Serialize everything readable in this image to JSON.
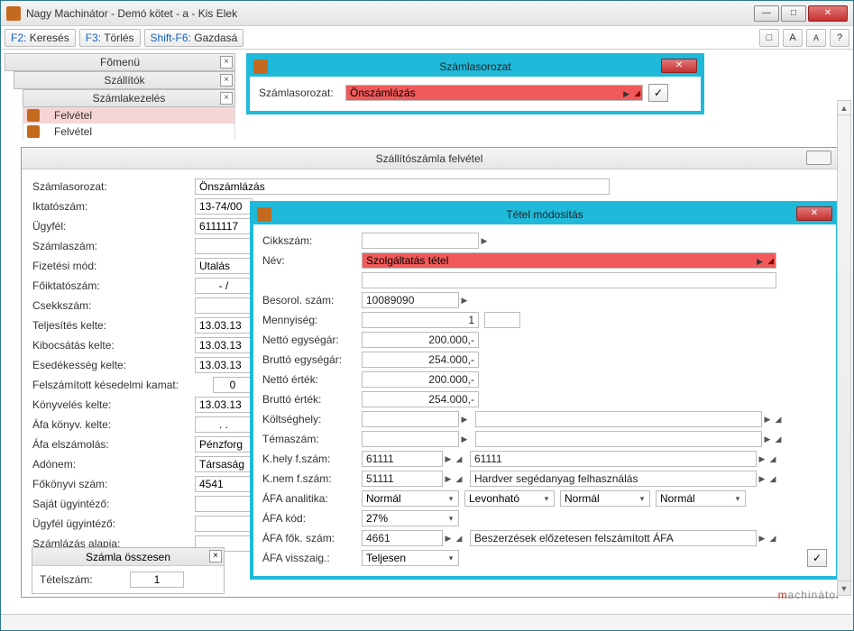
{
  "window": {
    "title": "Nagy Machinátor - Demó kötet - a - Kis Elek"
  },
  "toolbar": {
    "f2_hk": "F2:",
    "f2_lbl": "Keresés",
    "f3_hk": "F3:",
    "f3_lbl": "Törlés",
    "sf6_hk": "Shift-F6:",
    "sf6_lbl": "Gazdasá",
    "help": "?"
  },
  "panels": {
    "fomenu": "Fõmenü",
    "szallitok": "Szállítók",
    "szamlakezeles": "Számlakezelés",
    "felvetel1": "Felvétel",
    "felvetel2": "Felvétel"
  },
  "serial_modal": {
    "title": "Számlasorozat",
    "label": "Számlasorozat:",
    "value": "Önszámlázás"
  },
  "supplier_modal": {
    "title": "Szállítószámla felvétel",
    "rows": {
      "szamlasorozat_l": "Számlasorozat:",
      "szamlasorozat_v": "Önszámlázás",
      "iktatoszam_l": "Iktatószám:",
      "iktatoszam_v": "13-74/00",
      "ugyfel_l": "Ügyfél:",
      "ugyfel_v": "6111117",
      "szamlaszam_l": "Számlaszám:",
      "szamlaszam_v": "",
      "fizmod_l": "Fizetési mód:",
      "fizmod_v": "Utalás",
      "foiktato_l": "Főiktatószám:",
      "foiktato_v": "-   /",
      "csekkszam_l": "Csekkszám:",
      "csekkszam_v": "",
      "telj_l": "Teljesítés kelte:",
      "telj_v": "13.03.13",
      "kib_l": "Kibocsátás kelte:",
      "kib_v": "13.03.13",
      "esed_l": "Esedékesség kelte:",
      "esed_v": "13.03.13",
      "kesedelmi_l": "Felszámított késedelmi kamat:",
      "kesedelmi_v": "0",
      "konyv_l": "Könyvelés kelte:",
      "konyv_v": "13.03.13",
      "afakonyv_l": "Áfa könyv. kelte:",
      "afakonyv_v": ".   .",
      "afaelsz_l": "Áfa elszámolás:",
      "afaelsz_v": "Pénzforg",
      "adonem_l": "Adónem:",
      "adonem_v": "Társaság",
      "fokonyvi_l": "Főkönyvi szám:",
      "fokonyvi_v": "4541",
      "sajat_l": "Saját ügyintéző:",
      "sajat_v": "",
      "ugyfel_ugy_l": "Ügyfél ügyintéző:",
      "ugyfel_ugy_v": "",
      "alap_l": "Számlázás alapja:",
      "alap_v": ""
    }
  },
  "sum_panel": {
    "title": "Számla összesen",
    "tetelszam_l": "Tételszám:",
    "tetelszam_v": "1"
  },
  "item_modal": {
    "title": "Tétel módosítás",
    "cikkszam_l": "Cikkszám:",
    "cikkszam_v": "",
    "nev_l": "Név:",
    "nev_v": "Szolgáltatás tétel",
    "besorol_l": "Besorol. szám:",
    "besorol_v": "10089090",
    "menny_l": "Mennyiség:",
    "menny_v": "1",
    "netto_e_l": "Nettó egységár:",
    "netto_e_v": "200.000,-",
    "brutto_e_l": "Bruttó egységár:",
    "brutto_e_v": "254.000,-",
    "netto_ert_l": "Nettó érték:",
    "netto_ert_v": "200.000,-",
    "brutto_ert_l": "Bruttó érték:",
    "brutto_ert_v": "254.000,-",
    "koltseghely_l": "Költséghely:",
    "koltseghely_v": "",
    "temaszam_l": "Témaszám:",
    "temaszam_v": "",
    "khely_l": "K.hely f.szám:",
    "khely_v": "61111",
    "khely_v2": "61111",
    "knem_l": "K.nem f.szám:",
    "knem_v": "51111",
    "knem_desc": "Hardver segédanyag felhasználás",
    "afa_an_l": "ÁFA analitika:",
    "afa_an_v": "Normál",
    "afa_an_v2": "Levonható",
    "afa_an_v3": "Normál",
    "afa_an_v4": "Normál",
    "afa_kod_l": "ÁFA kód:",
    "afa_kod_v": "27%",
    "afa_fok_l": "ÁFA fők. szám:",
    "afa_fok_v": "4661",
    "afa_fok_desc": "Beszerzések előzetesen felszámított ÁFA",
    "afa_vissza_l": "ÁFA visszaig.:",
    "afa_vissza_v": "Teljesen"
  },
  "watermark": {
    "pre": "m",
    "mid": "achinátor"
  }
}
